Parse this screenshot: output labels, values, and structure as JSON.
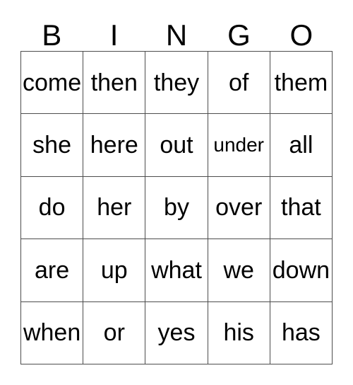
{
  "card": {
    "title": "BINGO",
    "header_letters": [
      "B",
      "I",
      "N",
      "G",
      "O"
    ],
    "colors": {
      "background": "#ffffff",
      "text": "#000000",
      "grid_line": "#4d4d4d"
    },
    "grid": {
      "columns": 5,
      "rows": 5,
      "cells": [
        [
          {
            "word": "come",
            "shrink": false
          },
          {
            "word": "then",
            "shrink": false
          },
          {
            "word": "they",
            "shrink": false
          },
          {
            "word": "of",
            "shrink": false
          },
          {
            "word": "them",
            "shrink": false
          }
        ],
        [
          {
            "word": "she",
            "shrink": false
          },
          {
            "word": "here",
            "shrink": false
          },
          {
            "word": "out",
            "shrink": false
          },
          {
            "word": "under",
            "shrink": true
          },
          {
            "word": "all",
            "shrink": false
          }
        ],
        [
          {
            "word": "do",
            "shrink": false
          },
          {
            "word": "her",
            "shrink": false
          },
          {
            "word": "by",
            "shrink": false
          },
          {
            "word": "over",
            "shrink": false
          },
          {
            "word": "that",
            "shrink": false
          }
        ],
        [
          {
            "word": "are",
            "shrink": false
          },
          {
            "word": "up",
            "shrink": false
          },
          {
            "word": "what",
            "shrink": false
          },
          {
            "word": "we",
            "shrink": false
          },
          {
            "word": "down",
            "shrink": false
          }
        ],
        [
          {
            "word": "when",
            "shrink": false
          },
          {
            "word": "or",
            "shrink": false
          },
          {
            "word": "yes",
            "shrink": false
          },
          {
            "word": "his",
            "shrink": false
          },
          {
            "word": "has",
            "shrink": false
          }
        ]
      ]
    }
  }
}
